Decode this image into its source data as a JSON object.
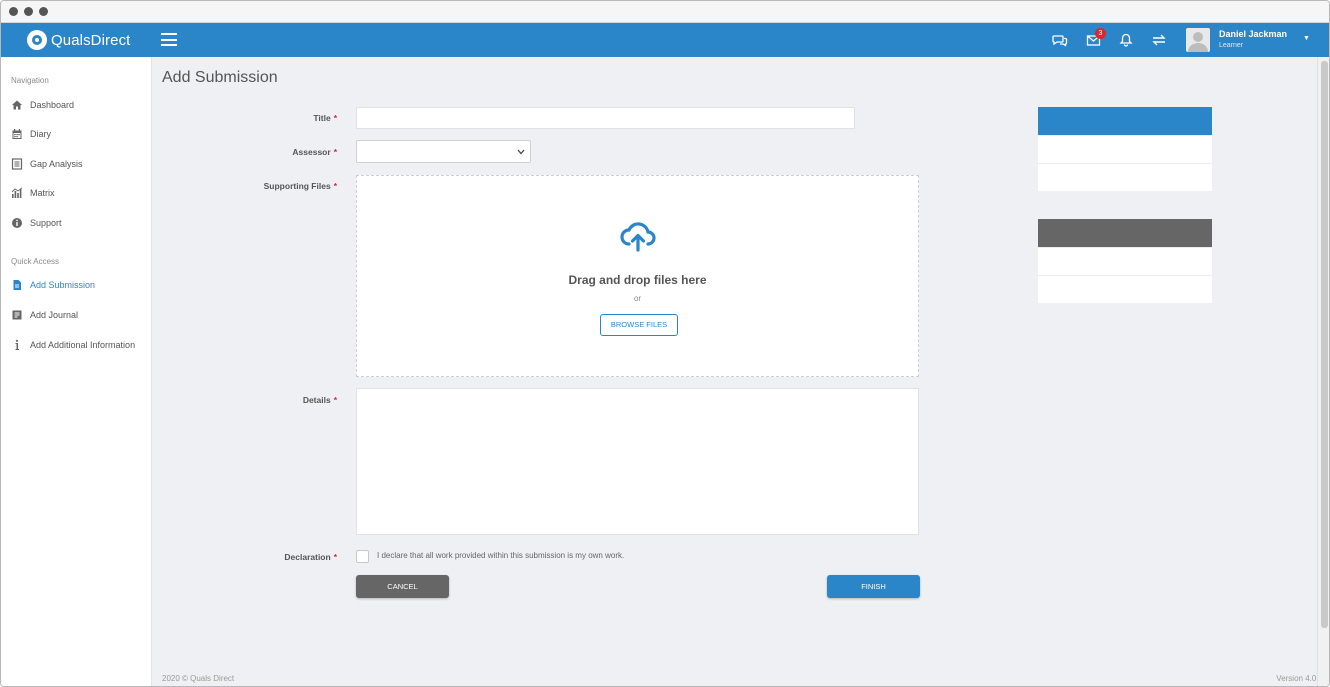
{
  "app": {
    "name": "QualsDirect"
  },
  "topbar": {
    "message_badge": "3",
    "user_name": "Daniel Jackman",
    "user_role": "Learner"
  },
  "sidebar": {
    "navigation_title": "Navigation",
    "navigation": [
      {
        "label": "Dashboard",
        "icon": "home-icon"
      },
      {
        "label": "Diary",
        "icon": "calendar-icon"
      },
      {
        "label": "Gap Analysis",
        "icon": "document-icon"
      },
      {
        "label": "Matrix",
        "icon": "matrix-icon"
      },
      {
        "label": "Support",
        "icon": "info-circle-icon"
      }
    ],
    "quick_access_title": "Quick Access",
    "quick_access": [
      {
        "label": "Add Submission",
        "icon": "file-icon",
        "active": true
      },
      {
        "label": "Add Journal",
        "icon": "journal-icon"
      },
      {
        "label": "Add Additional Information",
        "icon": "info-icon"
      }
    ]
  },
  "page": {
    "title": "Add Submission",
    "form": {
      "title_label": "Title",
      "title_value": "",
      "assessor_label": "Assessor",
      "assessor_value": "",
      "files_label": "Supporting Files",
      "dropzone_title": "Drag and drop files here",
      "dropzone_or": "or",
      "browse_label": "BROWSE FILES",
      "details_label": "Details",
      "details_value": "",
      "declaration_label": "Declaration",
      "declaration_text": "I declare that all work provided within this submission is my own work.",
      "required_mark": "*",
      "cancel_label": "CANCEL",
      "finish_label": "FINISH"
    }
  },
  "footer": {
    "copyright": "2020 © Quals Direct",
    "version": "Version 4.0.0"
  },
  "colors": {
    "brand": "#2a86c8",
    "card_dark": "#666666",
    "required": "#d9262b",
    "badge": "#e0262b"
  }
}
